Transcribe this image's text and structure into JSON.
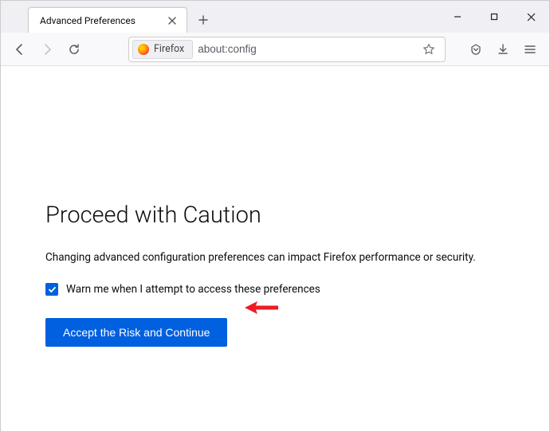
{
  "tab": {
    "title": "Advanced Preferences"
  },
  "urlbar": {
    "identity_label": "Firefox",
    "value": "about:config"
  },
  "page": {
    "heading": "Proceed with Caution",
    "description": "Changing advanced configuration preferences can impact Firefox performance or security.",
    "checkbox_label": "Warn me when I attempt to access these preferences",
    "checkbox_checked": true,
    "accept_label": "Accept the Risk and Continue"
  }
}
